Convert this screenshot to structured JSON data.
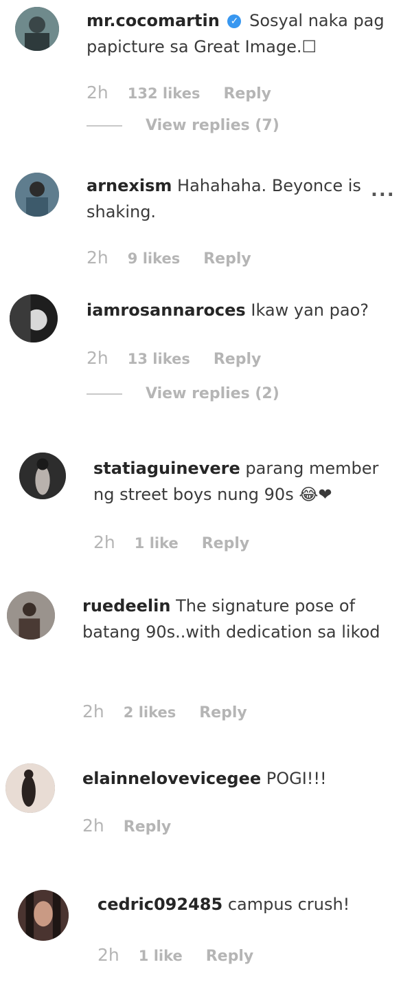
{
  "comments": [
    {
      "username": "mr.cocomartin",
      "verified": true,
      "text": "Sosyal naka pag papicture sa Great Image.☐",
      "time": "2h",
      "likes": "132 likes",
      "reply": "Reply",
      "view_replies": "View replies (7)",
      "avatar_color": "#4a5a5e"
    },
    {
      "username": "arnexism",
      "text": "Hahahaha. Beyonce is shaking.",
      "time": "2h",
      "likes": "9 likes",
      "reply": "Reply",
      "more": "...",
      "avatar_color": "#3d5a6b"
    },
    {
      "username": "iamrosannaroces",
      "text": "Ikaw yan pao?",
      "time": "2h",
      "likes": "13 likes",
      "reply": "Reply",
      "view_replies": "View replies (2)",
      "avatar_color": "#2a2a2a"
    },
    {
      "username": "statiaguinevere",
      "text": "parang member ng street boys nung 90s 😂❤",
      "time": "2h",
      "likes": "1 like",
      "reply": "Reply",
      "avatar_color": "#5a5a5a"
    },
    {
      "username": "ruedeelin",
      "text": "The signature pose of batang 90s..with dedication sa likod",
      "time": "2h",
      "likes": "2 likes",
      "reply": "Reply",
      "avatar_color": "#7a7470"
    },
    {
      "username": "elainnelovevicegee",
      "text": "POGI!!!",
      "time": "2h",
      "reply": "Reply",
      "avatar_color": "#c8b8ae"
    },
    {
      "username": "cedric092485",
      "text": "campus crush!",
      "time": "2h",
      "likes": "1 like",
      "reply": "Reply",
      "avatar_color": "#6b5048"
    }
  ]
}
